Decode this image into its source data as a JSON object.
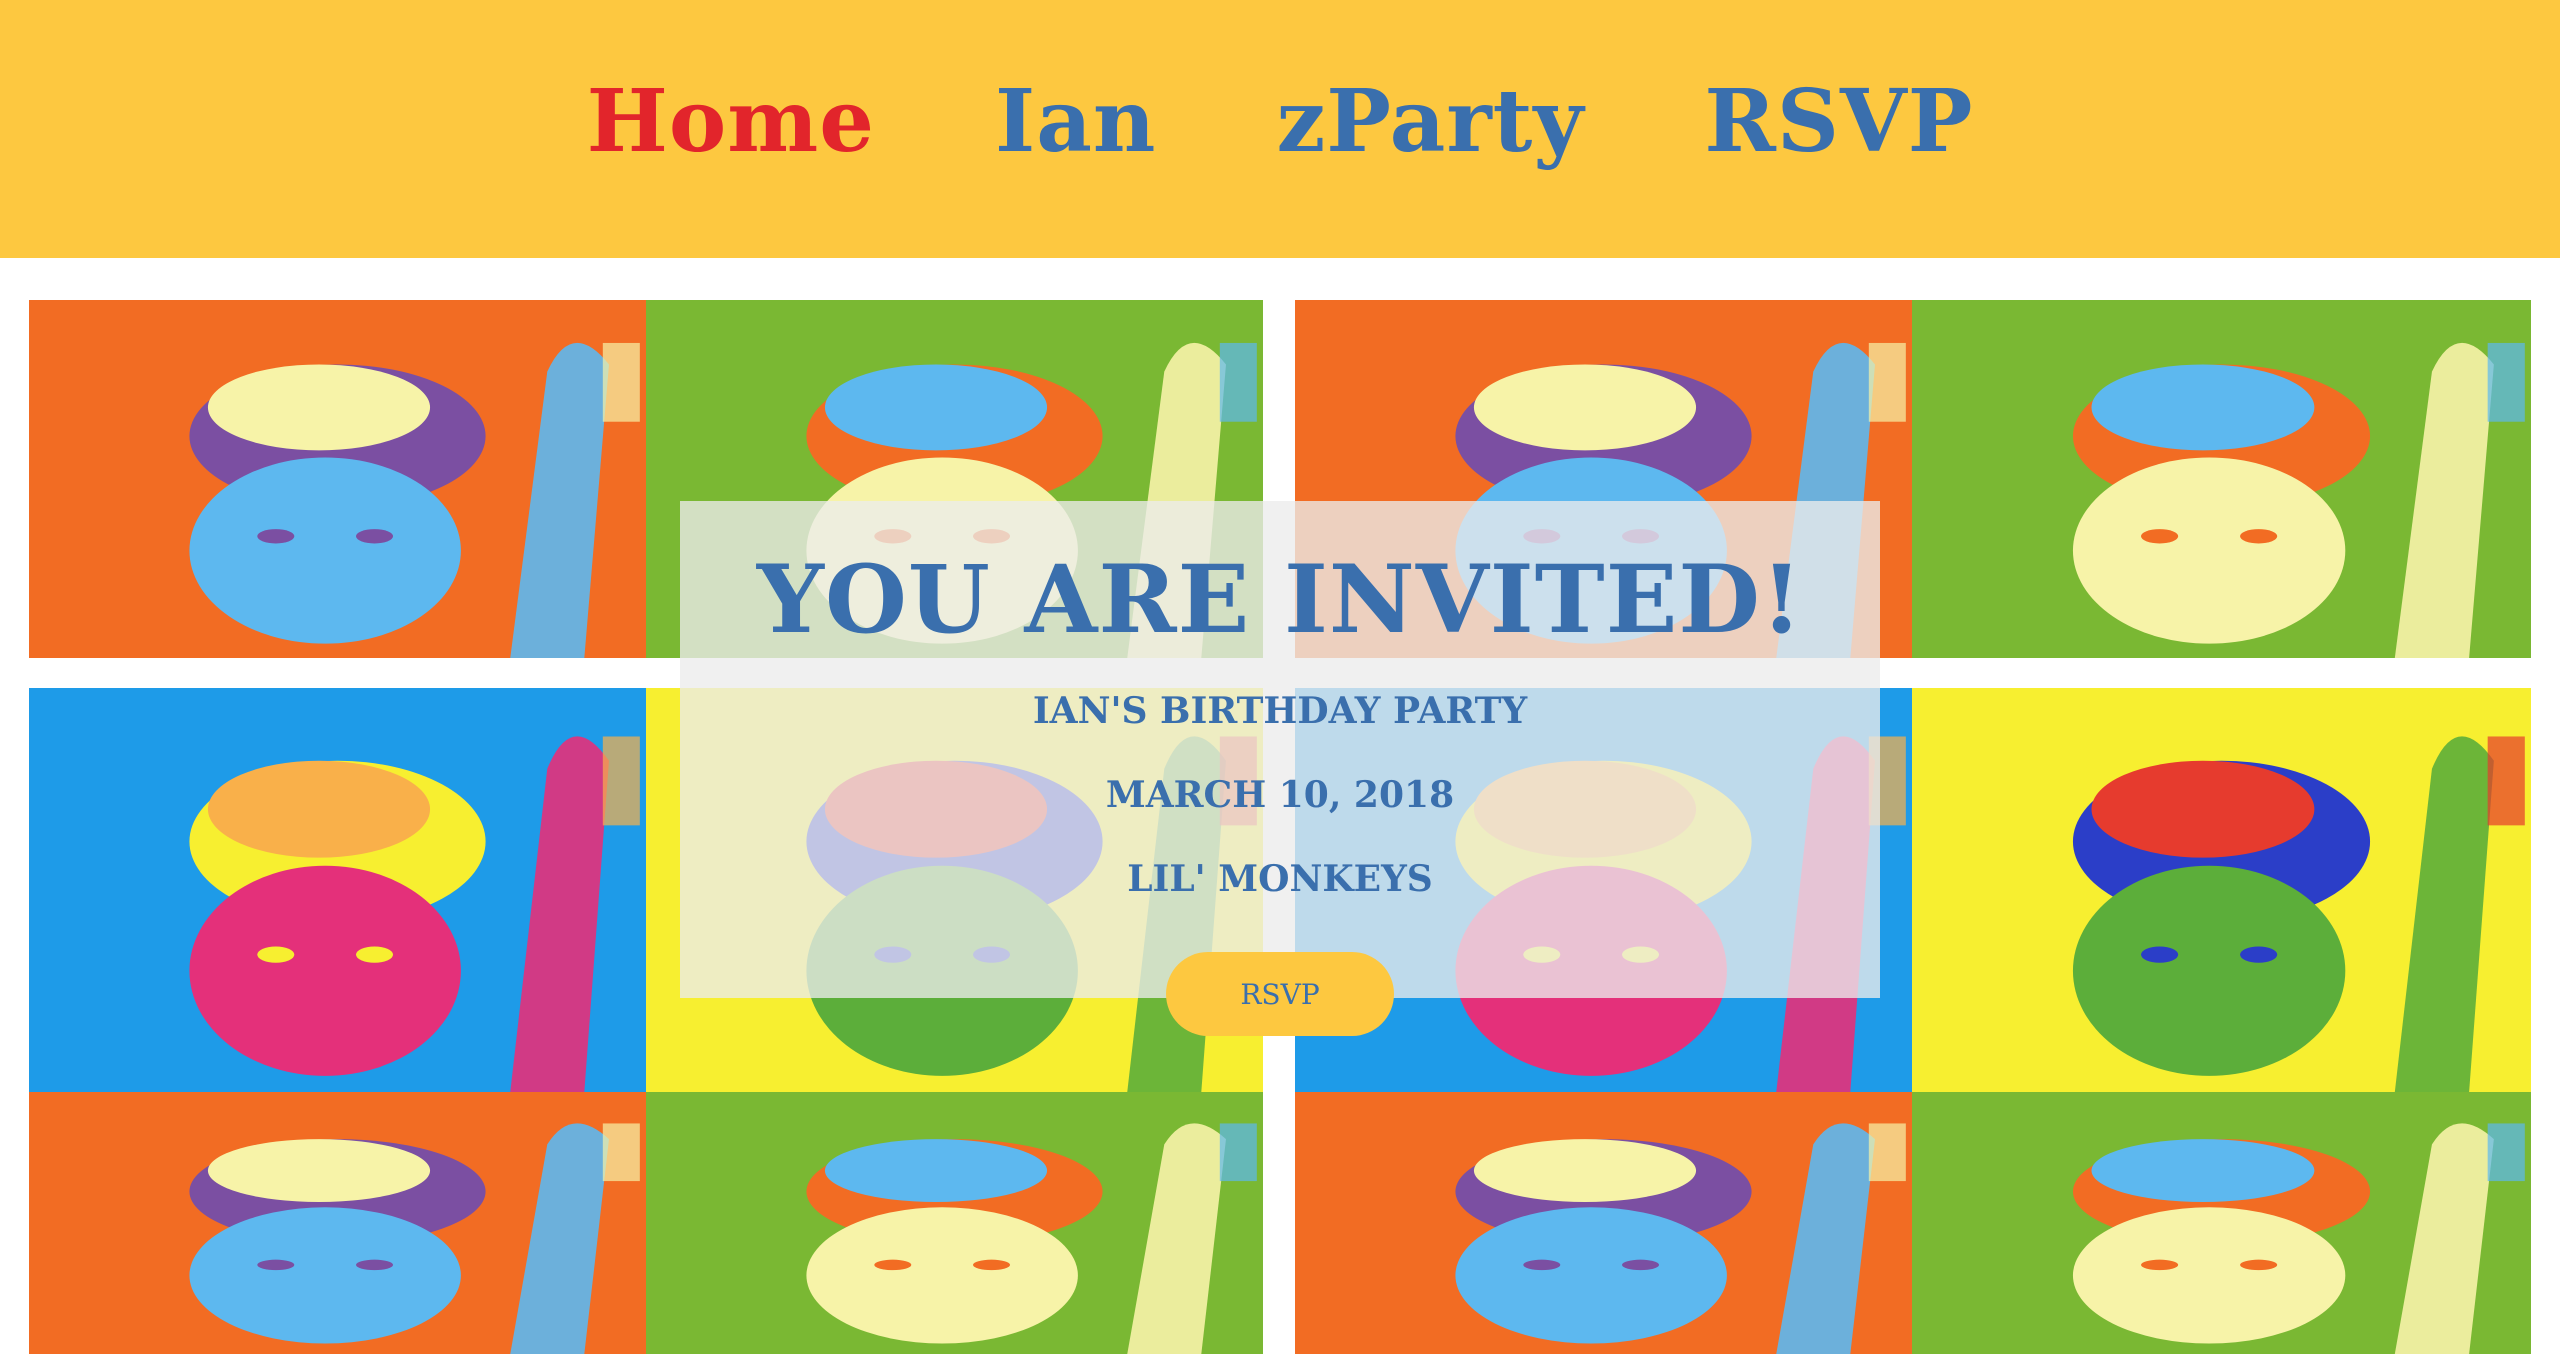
{
  "nav": {
    "items": [
      {
        "label": "Home",
        "active": true
      },
      {
        "label": "Ian",
        "active": false
      },
      {
        "label": "zParty",
        "active": false
      },
      {
        "label": "RSVP",
        "active": false
      }
    ],
    "bg_color": "#fdc840",
    "link_color": "#3a6fad",
    "active_color": "#e2252b"
  },
  "invite": {
    "title": "YOU ARE INVITED!",
    "lines": [
      "IAN'S BIRTHDAY PARTY",
      "MARCH 10, 2018",
      "LIL' MONKEYS"
    ],
    "button_label": "RSVP"
  },
  "photo_palettes": {
    "orange_purple": [
      "#f26c23",
      "#7b4fa2",
      "#5db8ef",
      "#f7f3a8"
    ],
    "green_orange": [
      "#7ab833",
      "#f26c23",
      "#f7f3a8",
      "#5db8ef"
    ],
    "blue_yellow": [
      "#1e9be8",
      "#f7ef30",
      "#e4307a",
      "#f9b04a"
    ],
    "yellow_blue": [
      "#f7ef30",
      "#2b3ec8",
      "#5cae3a",
      "#e63b2e"
    ]
  }
}
